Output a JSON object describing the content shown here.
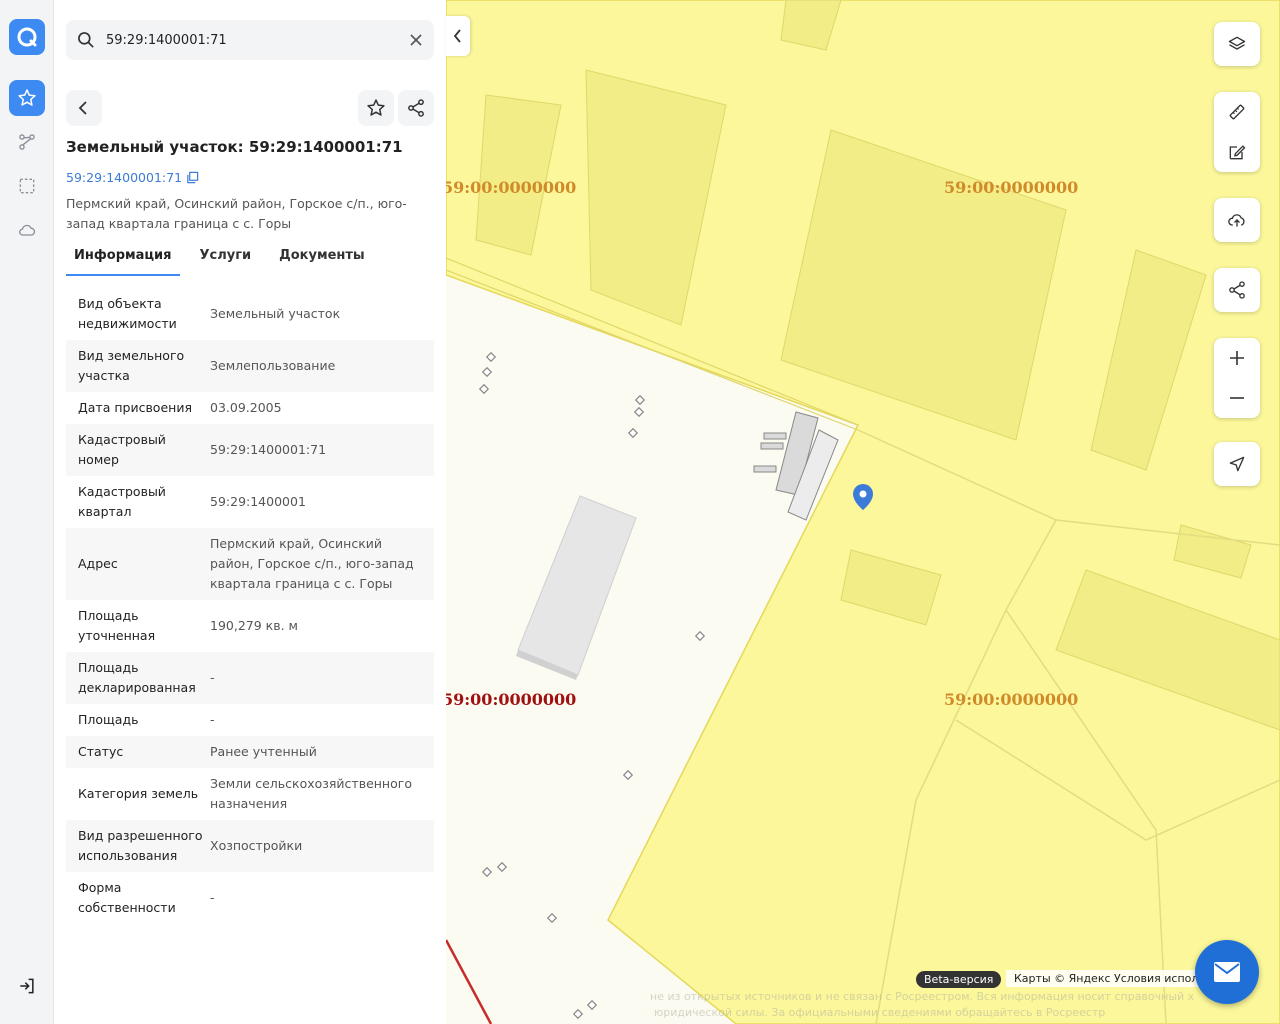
{
  "search": {
    "value": "59:29:1400001:71"
  },
  "object": {
    "title": "Земельный участок: 59:29:1400001:71",
    "cadastral_link": "59:29:1400001:71",
    "address": "Пермский край, Осинский район, Горское с/п., юго-запад квартала граница с с. Горы"
  },
  "tabs": [
    {
      "label": "Информация",
      "active": true
    },
    {
      "label": "Услуги",
      "active": false
    },
    {
      "label": "Документы",
      "active": false
    }
  ],
  "info_rows": [
    {
      "key": "Вид объекта недвижимости",
      "value": "Земельный участок"
    },
    {
      "key": "Вид земельного участка",
      "value": "Землепользование"
    },
    {
      "key": "Дата присвоения",
      "value": "03.09.2005"
    },
    {
      "key": "Кадастровый номер",
      "value": "59:29:1400001:71"
    },
    {
      "key": "Кадастровый квартал",
      "value": "59:29:1400001"
    },
    {
      "key": "Адрес",
      "value": "Пермский край, Осинский район, Горское с/п., юго-запад квартала граница с с. Горы"
    },
    {
      "key": "Площадь уточненная",
      "value": "190,279 кв. м"
    },
    {
      "key": "Площадь декларированная",
      "value": "-"
    },
    {
      "key": "Площадь",
      "value": "-"
    },
    {
      "key": "Статус",
      "value": "Ранее учтенный"
    },
    {
      "key": "Категория земель",
      "value": "Земли сельскохозяйственного назначения"
    },
    {
      "key": "Вид разрешенного использования",
      "value": "Хозпостройки"
    },
    {
      "key": "Форма собственности",
      "value": "-"
    }
  ],
  "map": {
    "labels": [
      "59:00:0000000",
      "59:00:0000000",
      "59:00:0000000",
      "59:00:0000000"
    ],
    "beta": "Beta-версия",
    "attribution": "Карты © Яндекс   Условия испол",
    "disclaimer_1": "не из открытых источников и не связан с Росреестром. Вся информация носит справочный х",
    "disclaimer_2": "юридической силы. За официальными сведениями обращайтесь в Росреестр"
  },
  "colors": {
    "accent": "#3d8bf2",
    "parcel_yellow": "#fbf79a",
    "label_orange": "#d08a2a",
    "label_red": "#a01010"
  }
}
